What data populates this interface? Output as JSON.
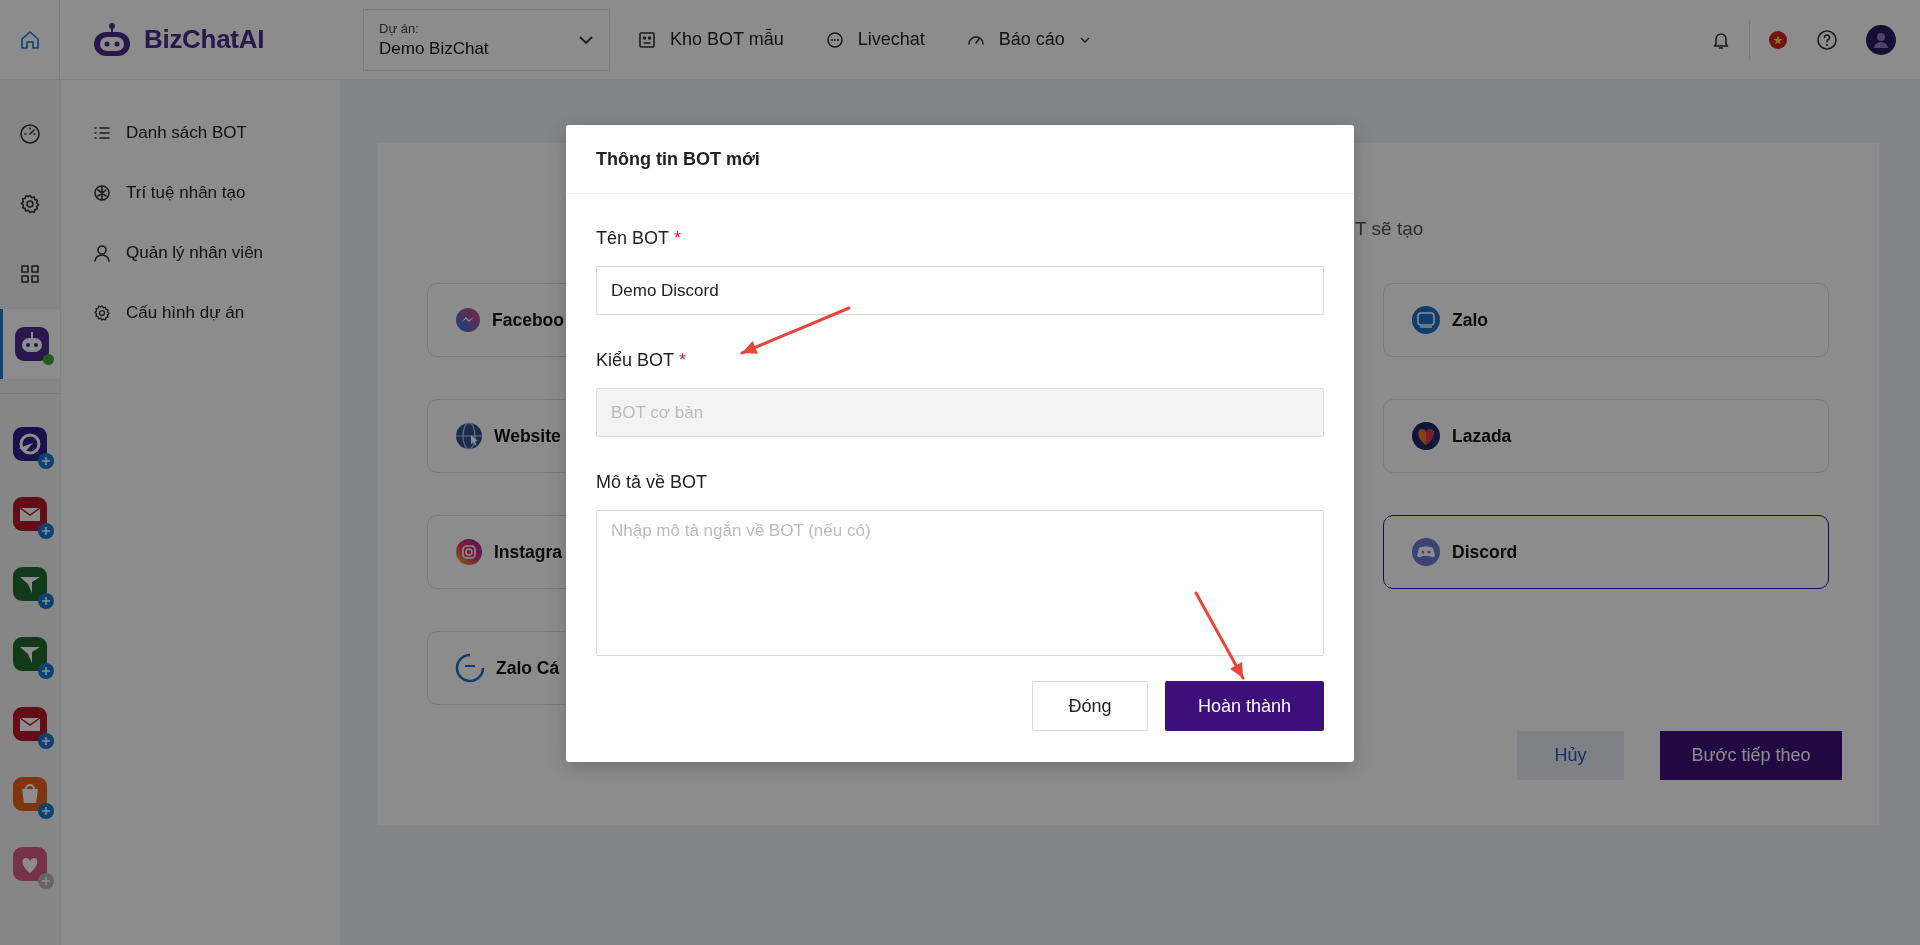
{
  "topbar": {
    "logo": "BizChatAI",
    "project": {
      "label": "Dự án:",
      "value": "Demo BizChat"
    },
    "nav": [
      {
        "label": "Kho BOT mẫu",
        "kind": "template",
        "dropdown": false
      },
      {
        "label": "Livechat",
        "kind": "chat",
        "dropdown": false
      },
      {
        "label": "Báo cáo",
        "kind": "report",
        "dropdown": true
      }
    ]
  },
  "rail": {
    "tools": [
      {
        "kind": "dashboard",
        "selected": false,
        "online": false
      },
      {
        "kind": "settings",
        "selected": false,
        "online": false
      },
      {
        "kind": "grid",
        "selected": false,
        "online": false
      },
      {
        "kind": "bot",
        "selected": true,
        "online": true
      }
    ],
    "apps": [
      {
        "kind": "plane-ring",
        "disabled": false
      },
      {
        "kind": "mail",
        "disabled": false
      },
      {
        "kind": "plane",
        "disabled": false
      },
      {
        "kind": "plane",
        "disabled": false
      },
      {
        "kind": "mail",
        "disabled": false
      },
      {
        "kind": "bag",
        "disabled": false
      },
      {
        "kind": "heart",
        "disabled": true
      }
    ]
  },
  "sidebar": {
    "items": [
      {
        "label": "Danh sách BOT",
        "kind": "list",
        "selected": false
      },
      {
        "label": "Trí tuệ nhân tạo",
        "kind": "ai",
        "selected": false
      },
      {
        "label": "Quản lý nhân viên",
        "kind": "user",
        "selected": false
      },
      {
        "label": "Cấu hình dự án",
        "kind": "settings",
        "selected": false
      }
    ]
  },
  "main": {
    "subtitle_fragment": "T sẽ tạo",
    "channel_columns": [
      {
        "items": [
          {
            "label": "Faceboo",
            "kind": "messenger",
            "selected": false
          },
          {
            "label": "Website",
            "kind": "web",
            "selected": false
          },
          {
            "label": "Instagra",
            "kind": "camera",
            "selected": false
          },
          {
            "label": "Zalo Cá",
            "kind": "zalo-ring",
            "selected": false
          }
        ]
      },
      {
        "items": [
          {
            "label": "Zalo",
            "kind": "zalo",
            "selected": false
          },
          {
            "label": "Lazada",
            "kind": "heart",
            "selected": false
          },
          {
            "label": "Discord",
            "kind": "gamepad",
            "selected": true
          }
        ]
      }
    ],
    "buttons": [
      {
        "label": "Hủy",
        "kind": "secondary"
      },
      {
        "label": "Bước tiếp theo",
        "kind": "primary"
      }
    ]
  },
  "modal": {
    "title": "Thông tin BOT mới",
    "fields": [
      {
        "label": "Tên BOT",
        "required_mark": "*",
        "kind": "input",
        "value": "Demo Discord",
        "disabled": false
      },
      {
        "label": "Kiểu BOT",
        "required_mark": "*",
        "kind": "input",
        "value": "BOT cơ bản",
        "disabled": true
      },
      {
        "label": "Mô tả về BOT",
        "kind": "textarea",
        "placeholder": "Nhập mô tả ngắn về BOT (nếu có)",
        "disabled": false
      }
    ],
    "buttons": [
      {
        "label": "Đóng",
        "kind": "secondary"
      },
      {
        "label": "Hoàn thành",
        "kind": "primary"
      }
    ],
    "annotations": [
      {
        "kind": "arrow"
      },
      {
        "kind": "arrow"
      }
    ]
  }
}
